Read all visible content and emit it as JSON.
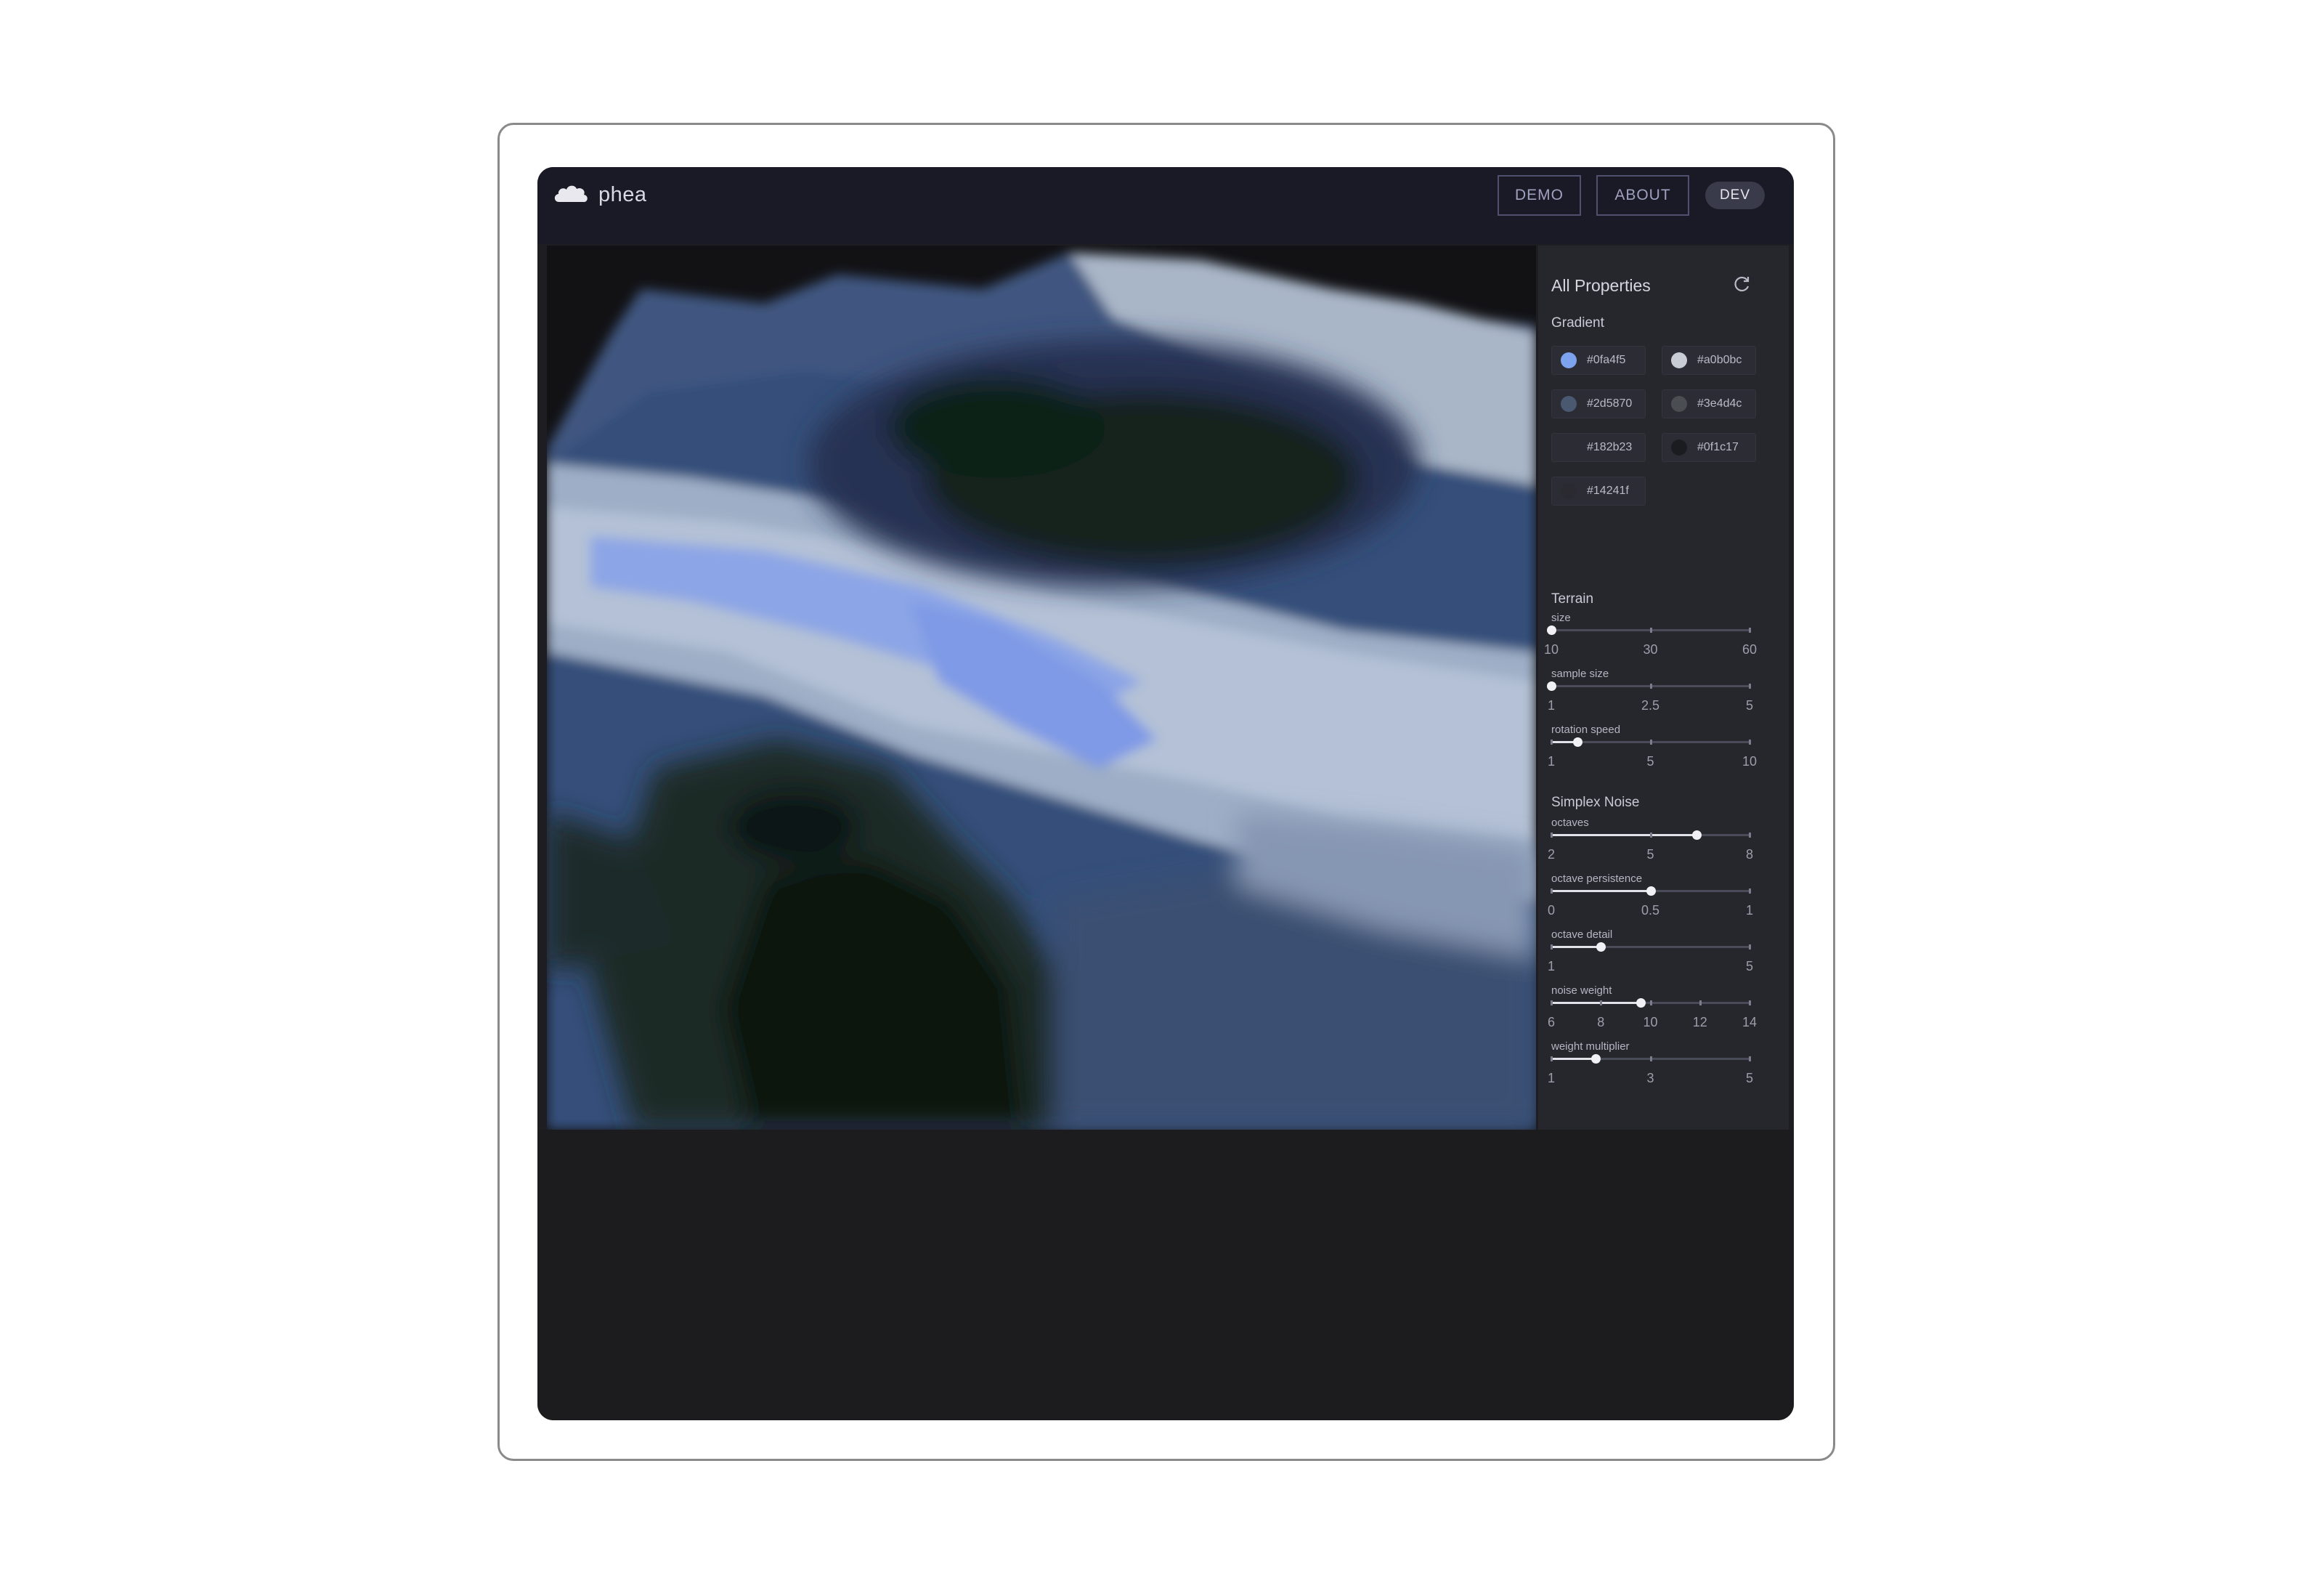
{
  "app": {
    "name": "phea",
    "nav": {
      "demo": "DEMO",
      "about": "ABOUT",
      "dev": "DEV"
    }
  },
  "panel": {
    "title": "All Properties",
    "reset_icon": "refresh-icon",
    "gradient": {
      "label": "Gradient",
      "colors": [
        {
          "hex": "#0fa4f5",
          "swatch": "#7ea3ee"
        },
        {
          "hex": "#a0b0bc",
          "swatch": "#c8ccd4"
        },
        {
          "hex": "#2d5870",
          "swatch": "#4a5870"
        },
        {
          "hex": "#3e4d4c",
          "swatch": "#4a4e52"
        },
        {
          "hex": "#182b23",
          "swatch": "#2c2c34"
        },
        {
          "hex": "#0f1c17",
          "swatch": "#1b1c20"
        },
        {
          "hex": "#14241f",
          "swatch": "#2a2a30"
        }
      ]
    },
    "terrain": {
      "label": "Terrain",
      "controls": [
        {
          "name": "size",
          "value": 10,
          "min": 10,
          "max": 60,
          "ticks": [
            "10",
            "30",
            "60"
          ]
        },
        {
          "name": "sample size",
          "value": 1,
          "min": 1,
          "max": 5,
          "ticks": [
            "1",
            "2.5",
            "5"
          ]
        },
        {
          "name": "rotation speed",
          "value": 2.2,
          "min": 1,
          "max": 10,
          "ticks": [
            "1",
            "5",
            "10"
          ]
        }
      ]
    },
    "simplex": {
      "label": "Simplex Noise",
      "controls": [
        {
          "name": "octaves",
          "value": 6.4,
          "min": 2,
          "max": 8,
          "ticks": [
            "2",
            "5",
            "8"
          ]
        },
        {
          "name": "octave persistence",
          "value": 0.5,
          "min": 0,
          "max": 1,
          "ticks": [
            "0",
            "0.5",
            "1"
          ]
        },
        {
          "name": "octave detail",
          "value": 2,
          "min": 1,
          "max": 5,
          "ticks": [
            "1",
            "5"
          ]
        },
        {
          "name": "noise weight",
          "value": 9.6,
          "min": 6,
          "max": 14,
          "ticks": [
            "6",
            "8",
            "10",
            "12",
            "14"
          ]
        },
        {
          "name": "weight multiplier",
          "value": 1.9,
          "min": 1,
          "max": 5,
          "ticks": [
            "1",
            "3",
            "5"
          ]
        }
      ]
    }
  }
}
